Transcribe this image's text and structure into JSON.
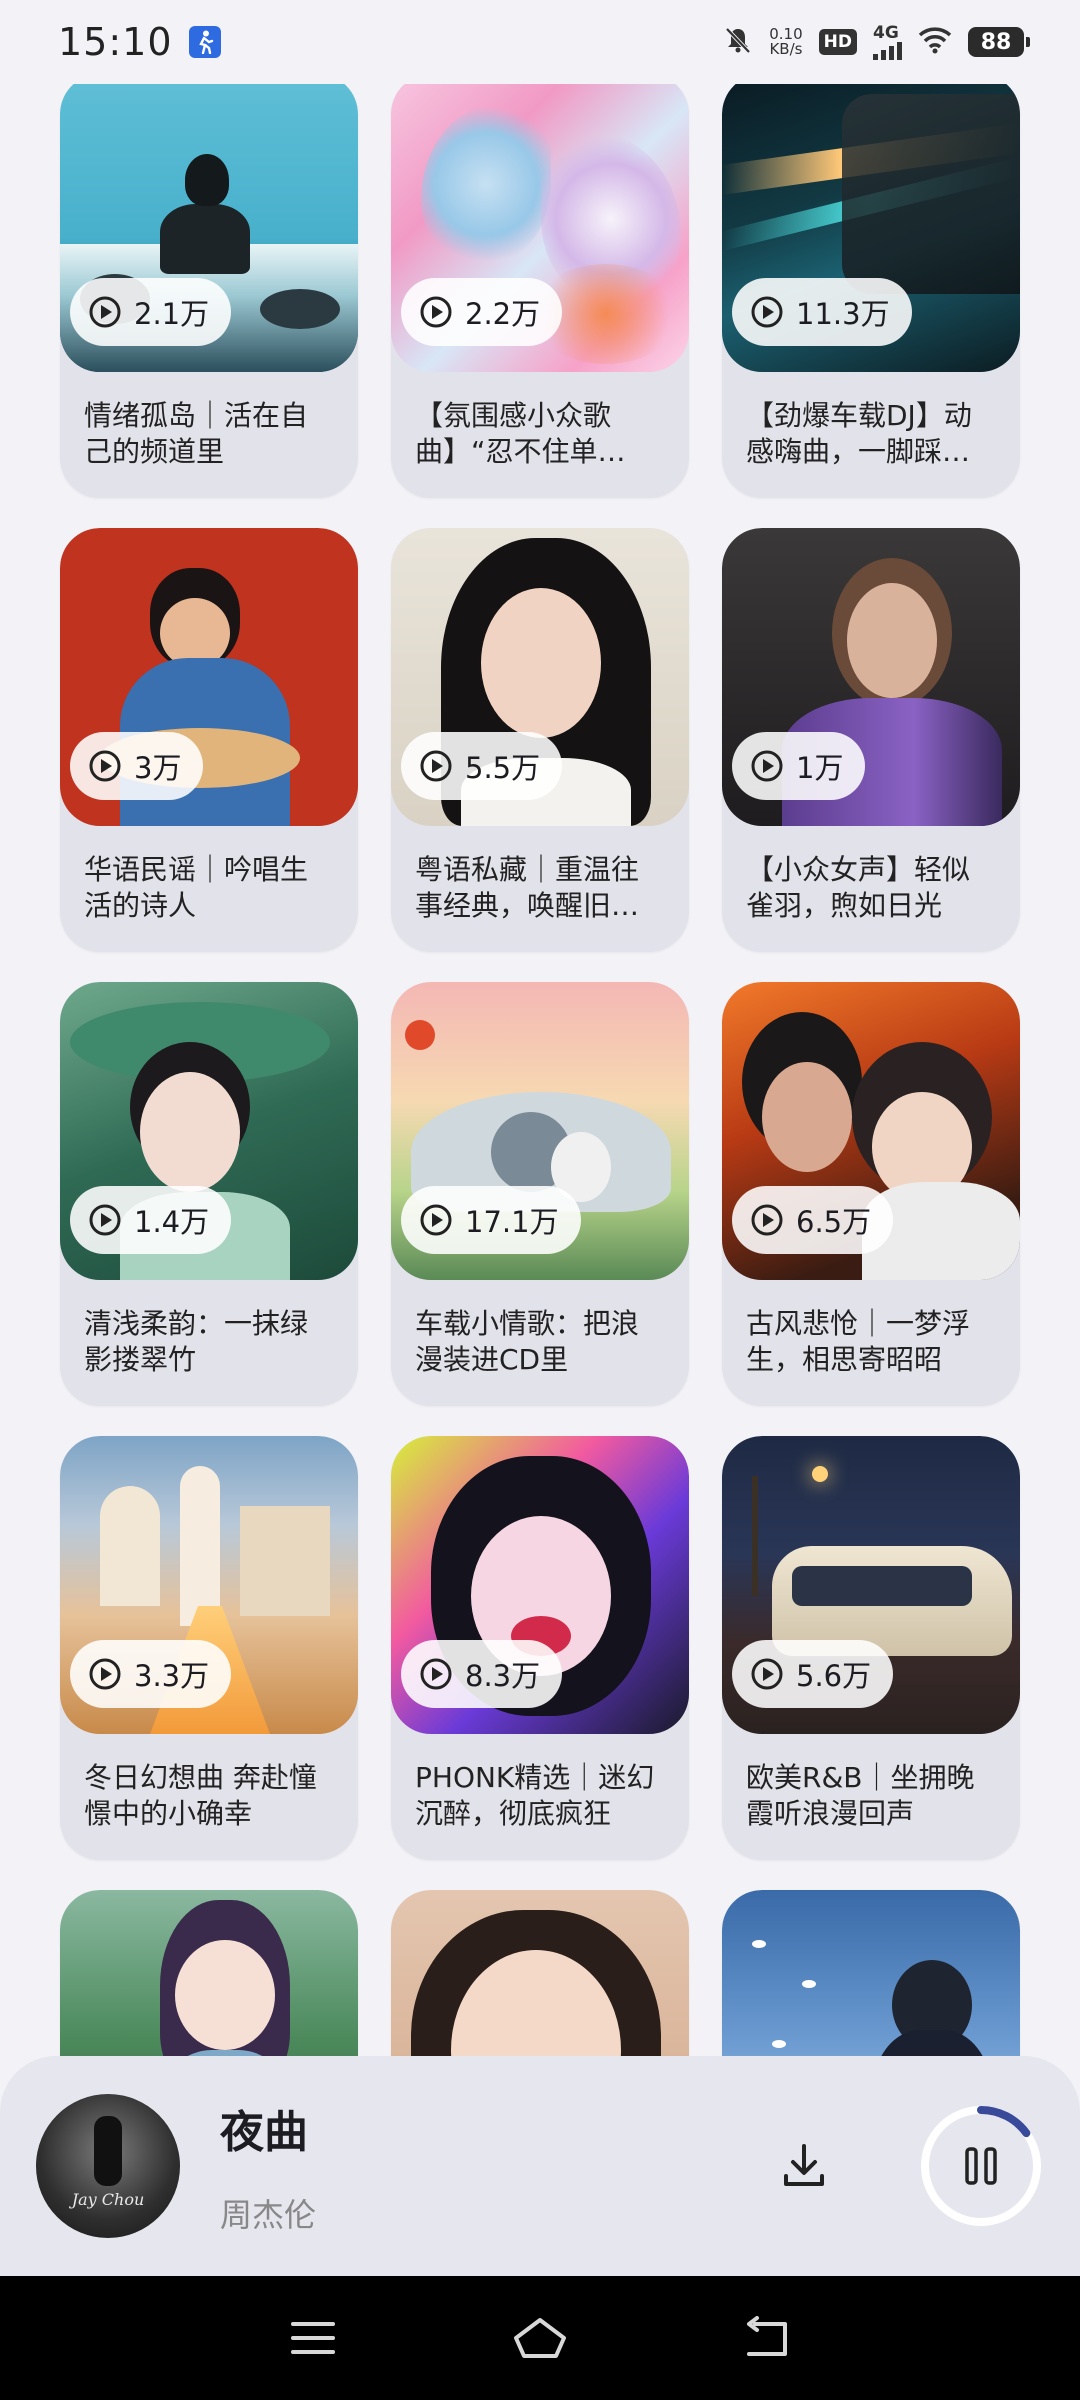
{
  "status_bar": {
    "time": "15:10",
    "net_speed_value": "0.10",
    "net_speed_unit": "KB/s",
    "hd_label": "HD",
    "network_label": "4G",
    "battery": "88"
  },
  "playlists": [
    {
      "plays": "2.1万",
      "title": "情绪孤岛｜活在自己的频道里"
    },
    {
      "plays": "2.2万",
      "title": "【氛围感小众歌曲】“忍不住单…"
    },
    {
      "plays": "11.3万",
      "title": "【劲爆车载DJ】动感嗨曲，一脚踩…"
    },
    {
      "plays": "3万",
      "title": "华语民谣｜吟唱生活的诗人"
    },
    {
      "plays": "5.5万",
      "title": "粤语私藏｜重温往事经典，唤醒旧…"
    },
    {
      "plays": "1万",
      "title": "【小众女声】轻似雀羽，煦如日光"
    },
    {
      "plays": "1.4万",
      "title": "清浅柔韵：一抹绿影搂翠竹"
    },
    {
      "plays": "17.1万",
      "title": "车载小情歌：把浪漫装进CD里"
    },
    {
      "plays": "6.5万",
      "title": "古风悲怆｜一梦浮生，相思寄昭昭"
    },
    {
      "plays": "3.3万",
      "title": "冬日幻想曲 奔赴憧憬中的小确幸"
    },
    {
      "plays": "8.3万",
      "title": "PHONK精选｜迷幻沉醉，彻底疯狂"
    },
    {
      "plays": "5.6万",
      "title": "欧美R&B｜坐拥晚霞听浪漫回声"
    },
    {
      "plays": "",
      "title": ""
    },
    {
      "plays": "",
      "title": ""
    },
    {
      "plays": "",
      "title": ""
    }
  ],
  "now_playing": {
    "title": "夜曲",
    "artist": "周杰伦",
    "art_text": "Jay Chou",
    "progress": 0.15
  },
  "nav": {
    "menu_icon": "menu-icon",
    "home_icon": "home-icon",
    "back_icon": "back-icon"
  },
  "colors": {
    "background": "#f2f2f7",
    "card": "#e2e2ea",
    "progress_accent": "#3a4a9a"
  }
}
